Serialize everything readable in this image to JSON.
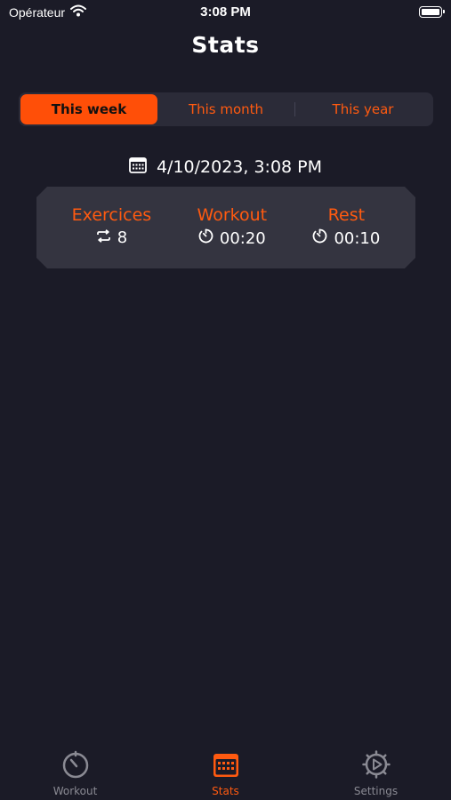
{
  "status_bar": {
    "carrier": "Opérateur",
    "time": "3:08 PM",
    "icons": [
      "wifi-icon",
      "battery-icon"
    ]
  },
  "page": {
    "title": "Stats"
  },
  "period_tabs": [
    {
      "label": "This week",
      "selected": true
    },
    {
      "label": "This month",
      "selected": false
    },
    {
      "label": "This year",
      "selected": false
    }
  ],
  "date": {
    "icon": "calendar-icon",
    "text": "4/10/2023, 3:08 PM"
  },
  "summary": {
    "exercises": {
      "label": "Exercices",
      "value": "8",
      "icon": "repeat-icon"
    },
    "workout": {
      "label": "Workout",
      "value": "00:20",
      "icon": "timer-icon"
    },
    "rest": {
      "label": "Rest",
      "value": "00:10",
      "icon": "timer-icon"
    }
  },
  "tab_bar": [
    {
      "label": "Workout",
      "icon": "stopwatch-icon",
      "active": false
    },
    {
      "label": "Stats",
      "icon": "calendar-icon",
      "active": true
    },
    {
      "label": "Settings",
      "icon": "gear-play-icon",
      "active": false
    }
  ],
  "colors": {
    "background": "#1b1b27",
    "accent": "#ff4f08",
    "card": "#343440",
    "inactive": "#8a8a93"
  }
}
